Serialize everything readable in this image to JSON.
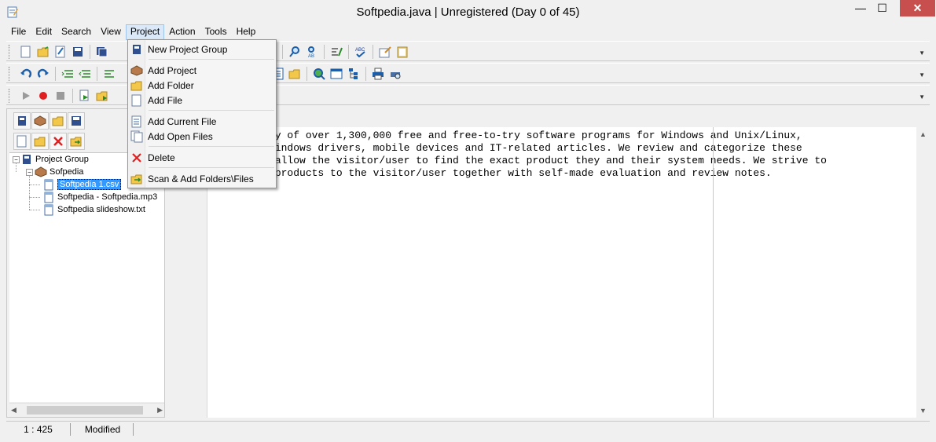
{
  "window": {
    "title": "Softpedia.java | Unregistered (Day 0 of 45)",
    "minimize": "—",
    "maximize": "☐",
    "close": "✕"
  },
  "menu": [
    "File",
    "Edit",
    "Search",
    "View",
    "Project",
    "Action",
    "Tools",
    "Help"
  ],
  "project_menu": {
    "items": [
      {
        "label": "New Project Group",
        "icon": "project-group-icon"
      },
      {
        "label": "Add Project",
        "icon": "add-project-icon"
      },
      {
        "label": "Add Folder",
        "icon": "folder-icon"
      },
      {
        "label": "Add File",
        "icon": "file-icon"
      },
      {
        "label": "Add Current File",
        "icon": "current-file-icon"
      },
      {
        "label": "Add Open Files",
        "icon": "open-files-icon"
      },
      {
        "label": "Delete",
        "icon": "delete-icon"
      },
      {
        "label": "Scan & Add Folders\\Files",
        "icon": "scan-add-icon"
      }
    ]
  },
  "tree": {
    "root": "Project Group",
    "project": "Sofpedia",
    "files": [
      "Softpedia 1.csv",
      "Softpedia - Softpedia.mp3",
      "Softpedia slideshow.txt"
    ],
    "selected_index": 0
  },
  "editor": {
    "lines": [
      "is a library of over 1,300,000 free and free-to-try software programs for Windows and Unix/Linux,",
      "software, Windows drivers, mobile devices and IT-related articles. We review and categorize these",
      "n order to allow the visitor/user to find the exact product they and their system needs. We strive to",
      "y the best products to the visitor/user together with self-made evaluation and review notes."
    ]
  },
  "status": {
    "position": "1 : 425",
    "state": "Modified"
  }
}
